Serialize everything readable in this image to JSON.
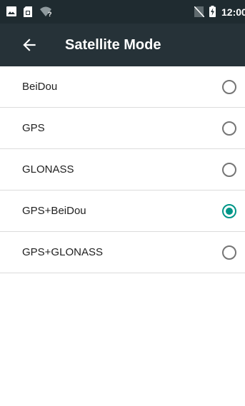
{
  "status_bar": {
    "time": "12:00",
    "left_icons": [
      "image-icon",
      "sim-icon",
      "wifi-unknown-icon"
    ],
    "right_icons": [
      "no-sim-icon",
      "battery-charging-icon"
    ]
  },
  "toolbar": {
    "back_icon": "arrow-left-icon",
    "title": "Satellite Mode"
  },
  "options": [
    {
      "label": "BeiDou",
      "selected": false
    },
    {
      "label": "GPS",
      "selected": false
    },
    {
      "label": "GLONASS",
      "selected": false
    },
    {
      "label": "GPS+BeiDou",
      "selected": true
    },
    {
      "label": "GPS+GLONASS",
      "selected": false
    }
  ],
  "colors": {
    "status_bar_bg": "#1f2b30",
    "toolbar_bg": "#263238",
    "accent": "#009688",
    "radio_off": "#757575",
    "divider": "#dcdcdc"
  }
}
